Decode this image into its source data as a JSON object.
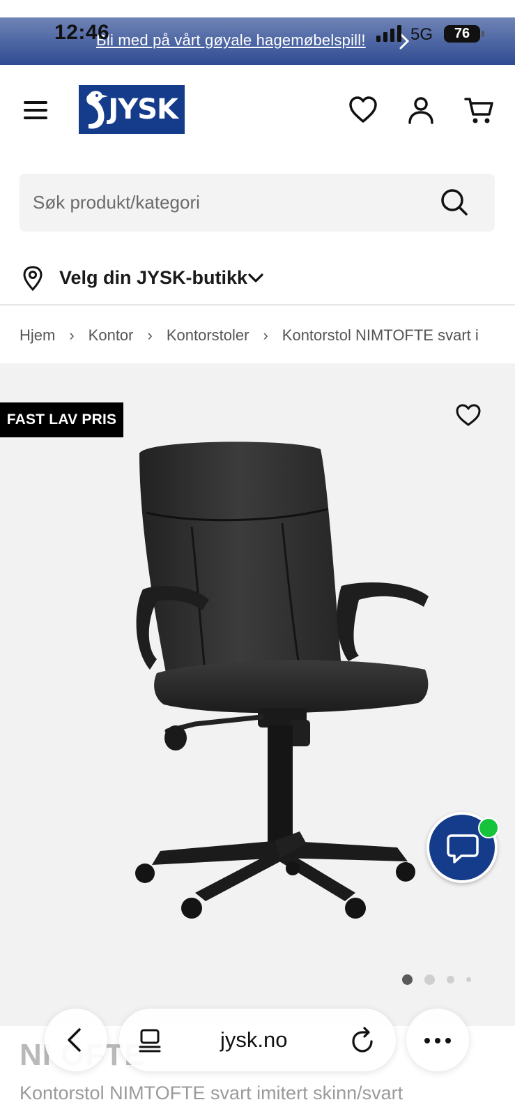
{
  "status_bar": {
    "time": "12:46",
    "network": "5G",
    "battery": "76"
  },
  "promo": {
    "text": "Bli med på vårt gøyale hagemøbelspill!"
  },
  "header": {
    "logo_text": "JYSK"
  },
  "search": {
    "placeholder": "Søk produkt/kategori"
  },
  "store": {
    "label": "Velg din JYSK-butikk"
  },
  "breadcrumb": [
    "Hjem",
    "Kontor",
    "Kontorstoler",
    "Kontorstol NIMTOFTE svart i"
  ],
  "product": {
    "badge": "FAST LAV PRIS",
    "name_partial": "NI   OFTE",
    "subtitle": "Kontorstol NIMTOFTE svart imitert skinn/svart",
    "image_count": 4,
    "active_image": 1
  },
  "browser": {
    "url": "jysk.no"
  },
  "colors": {
    "brand_blue": "#143C8A",
    "online_green": "#18c33c",
    "badge_black": "#000000"
  }
}
